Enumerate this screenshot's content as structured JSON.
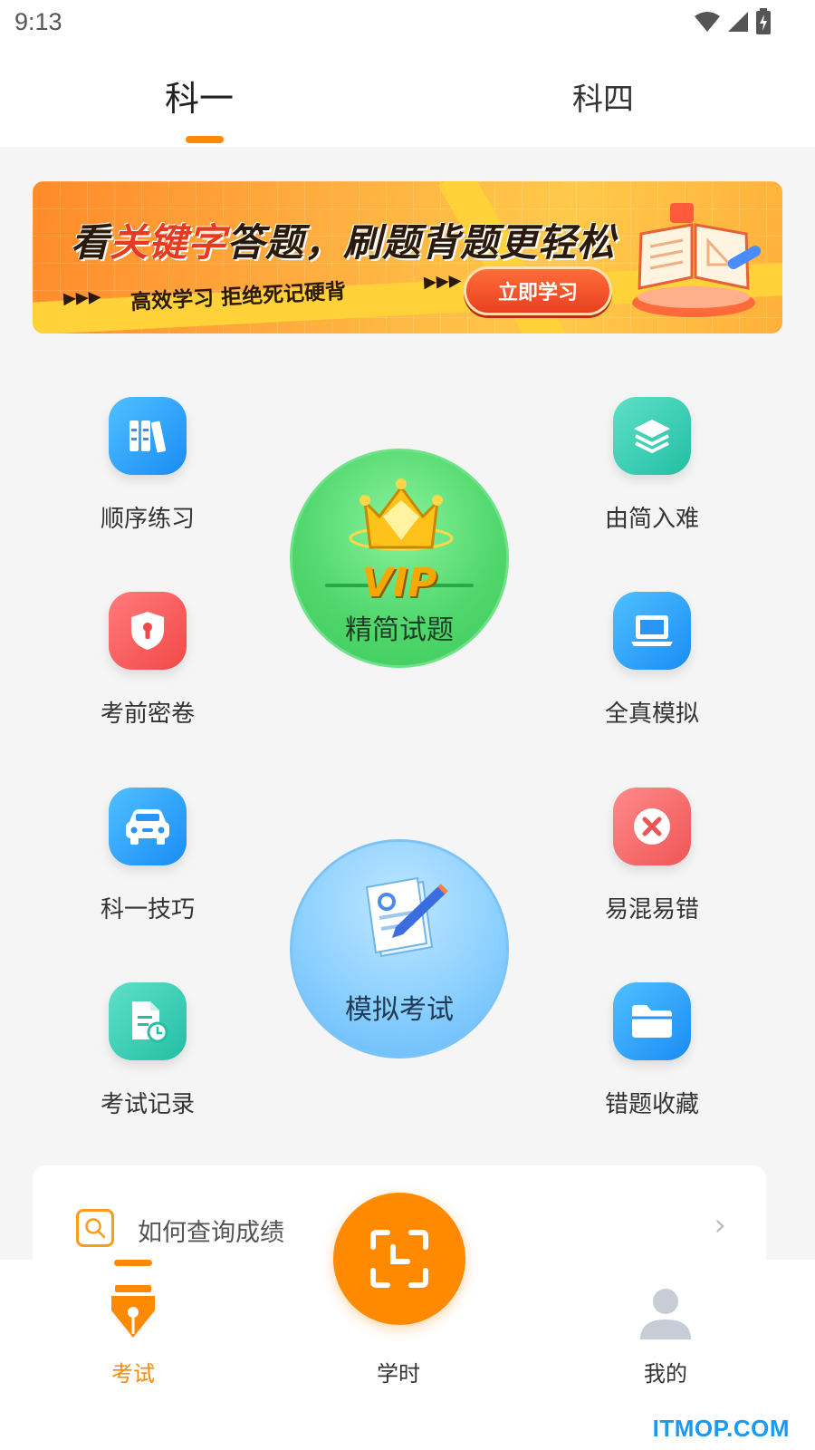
{
  "status_bar": {
    "time": "9:13"
  },
  "tabs": [
    {
      "label": "科一",
      "active": true
    },
    {
      "label": "科四",
      "active": false
    }
  ],
  "banner": {
    "headline_part1": "看",
    "headline_highlight": "关键字",
    "headline_part2": "答题，刷题背题更轻松",
    "subtitle": "高效学习 拒绝死记硬背",
    "button_label": "立即学习"
  },
  "grid": {
    "left": [
      {
        "label": "顺序练习",
        "icon": "books-icon"
      },
      {
        "label": "考前密卷",
        "icon": "shield-lock-icon"
      },
      {
        "label": "科一技巧",
        "icon": "car-icon"
      },
      {
        "label": "考试记录",
        "icon": "document-clock-icon"
      }
    ],
    "right": [
      {
        "label": "由简入难",
        "icon": "layers-icon"
      },
      {
        "label": "全真模拟",
        "icon": "laptop-icon"
      },
      {
        "label": "易混易错",
        "icon": "close-circle-icon"
      },
      {
        "label": "错题收藏",
        "icon": "folder-icon"
      }
    ]
  },
  "vip_circle": {
    "badge": "VIP",
    "label": "精简试题"
  },
  "exam_circle": {
    "label": "模拟考试"
  },
  "tip": {
    "text": "如何查询成绩"
  },
  "bottom_nav": {
    "exam": "考试",
    "hours": "学时",
    "me": "我的"
  },
  "watermark": "ITMOP.COM",
  "colors": {
    "accent": "#ff8a00",
    "vip_green": "#52d86e",
    "exam_blue": "#8cd0ff"
  }
}
